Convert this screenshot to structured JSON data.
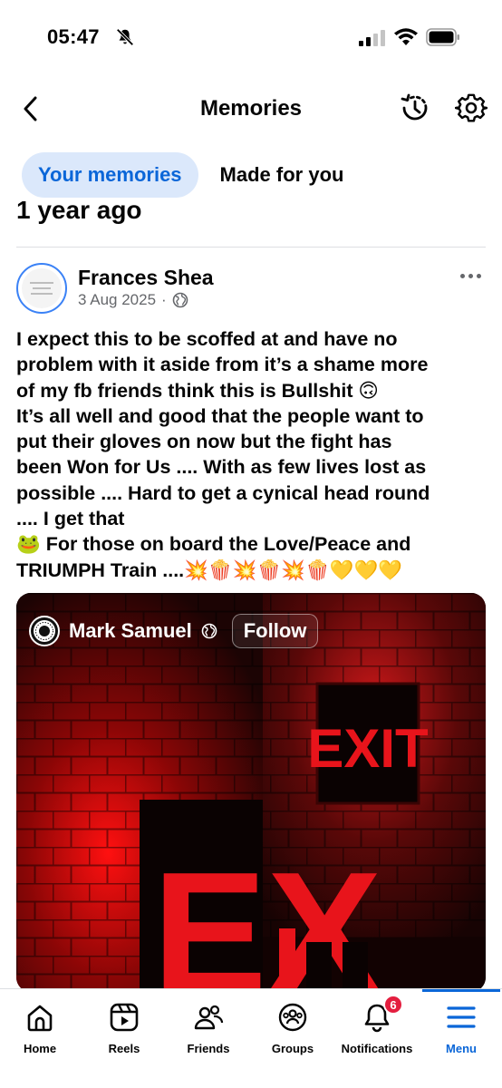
{
  "status_bar": {
    "time": "05:47"
  },
  "header": {
    "title": "Memories"
  },
  "tabs": [
    {
      "label": "Your memories",
      "active": true
    },
    {
      "label": "Made for you",
      "active": false
    }
  ],
  "section_heading": "1 year ago",
  "post": {
    "author": "Frances Shea",
    "date": "3 Aug 2025",
    "separator": "·",
    "audience_icon": "globe-icon",
    "lines": [
      "I expect this to be scoffed at and have no",
      "problem with it aside from it’s a shame more",
      "of my fb friends think this is Bullshit 🙃",
      "It’s all well and good that the people want to",
      "put their gloves on now but the fight has",
      "been Won for Us .... With as few lives lost as",
      "possible .... Hard to get a cynical head round",
      ".... I get that",
      "🐸 For those on board the Love/Peace and",
      "TRIUMPH Train ....💥🍿💥🍿💥🍿💛💛💛"
    ]
  },
  "shared": {
    "owner": "Mark Samuel",
    "follow_label": "Follow",
    "sign_text": "EXIT",
    "big_sign_text": "EX"
  },
  "bottom_nav": {
    "items": [
      {
        "label": "Home",
        "icon": "home-icon"
      },
      {
        "label": "Reels",
        "icon": "reels-icon"
      },
      {
        "label": "Friends",
        "icon": "friends-icon"
      },
      {
        "label": "Groups",
        "icon": "groups-icon"
      },
      {
        "label": "Notifications",
        "icon": "bell-icon",
        "badge": "6"
      },
      {
        "label": "Menu",
        "icon": "menu-icon",
        "active": true
      }
    ]
  },
  "colors": {
    "accent": "#0a66d8",
    "tab_active_bg": "#dbe8fb",
    "badge": "#e41e3f",
    "exit_red": "#e8141b"
  }
}
